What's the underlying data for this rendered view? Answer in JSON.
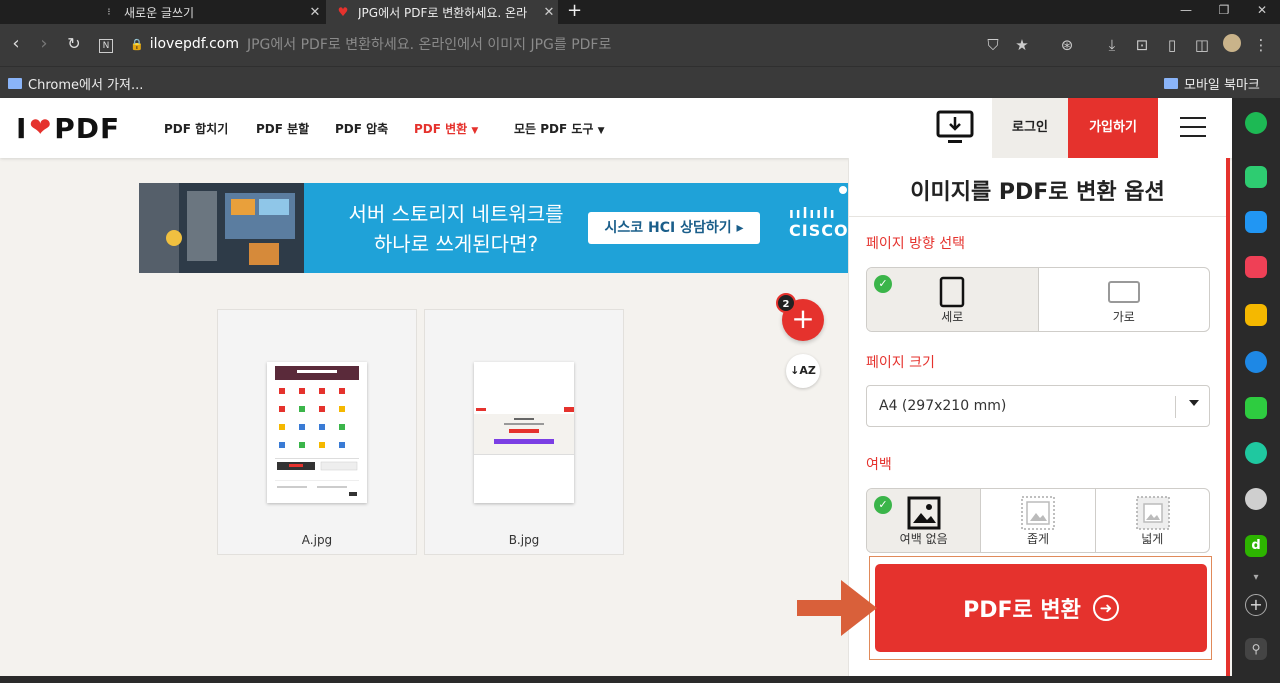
{
  "browser": {
    "tabs": [
      {
        "label": "새로운 글쓰기",
        "icon": "dots-icon"
      },
      {
        "label": "JPG에서 PDF로 변환하세요. 온라",
        "icon": "ilovepdf-heart-icon"
      }
    ],
    "new_tab_label": "+",
    "url_host": "ilovepdf.com",
    "url_rest": "JPG에서 PDF로 변환하세요. 온라인에서 이미지 JPG를 PDF로",
    "bookmark_left": "Chrome에서 가져...",
    "bookmark_right": "모바일 북마크"
  },
  "site": {
    "logo_left": "I",
    "logo_right": "PDF",
    "nav": [
      {
        "label": "PDF 합치기",
        "active": false
      },
      {
        "label": "PDF 분할",
        "active": false
      },
      {
        "label": "PDF 압축",
        "active": false
      },
      {
        "label": "PDF 변환",
        "active": true
      },
      {
        "label": "모든 PDF 도구",
        "active": false
      }
    ],
    "login": "로그인",
    "signup": "가입하기"
  },
  "ad": {
    "text_line1": "서버 스토리지 네트워크를",
    "text_line2": "하나로 쓰게된다면?",
    "cta": "시스코 HCI 상담하기 ▸",
    "brand": "CISCO"
  },
  "files": [
    {
      "name": "A.jpg"
    },
    {
      "name": "B.jpg"
    }
  ],
  "file_count_badge": "2",
  "panel": {
    "title": "이미지를 PDF로 변환 옵션",
    "orientation_label": "페이지 방향 선택",
    "orientation_options": [
      "세로",
      "가로"
    ],
    "orientation_selected": "세로",
    "size_label": "페이지 크기",
    "size_value": "A4 (297x210 mm)",
    "margin_label": "여백",
    "margin_options": [
      "여백 없음",
      "좁게",
      "넓게"
    ],
    "margin_selected": "여백 없음",
    "convert_button": "PDF로 변환"
  },
  "colors": {
    "brand_red": "#e5322d",
    "check_green": "#3bb54a",
    "ad_blue": "#1fa2d8"
  }
}
